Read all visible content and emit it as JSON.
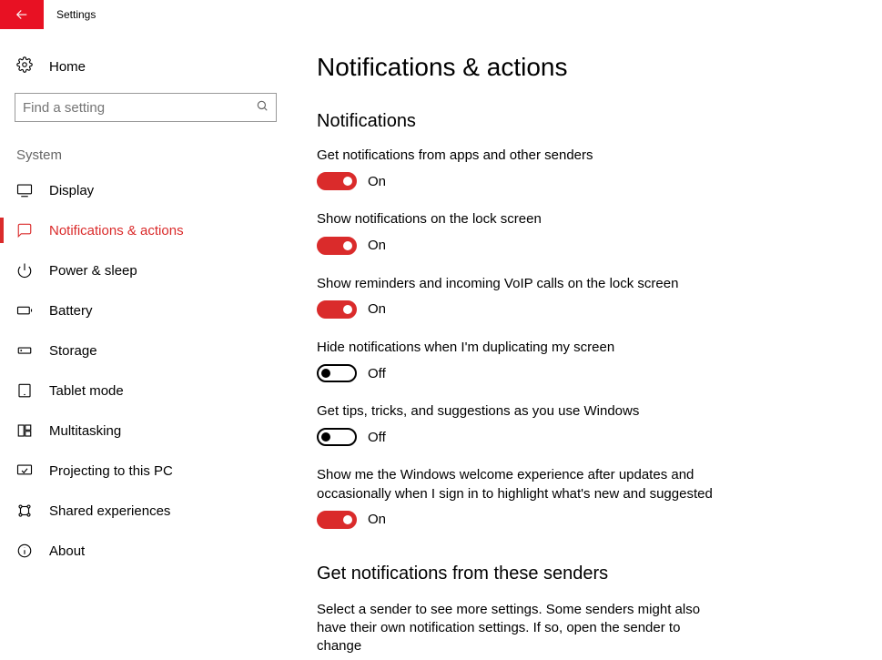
{
  "titlebar": {
    "app_name": "Settings"
  },
  "sidebar": {
    "home_label": "Home",
    "search_placeholder": "Find a setting",
    "group_label": "System",
    "items": [
      {
        "id": "display",
        "label": "Display",
        "icon": "display",
        "active": false
      },
      {
        "id": "notifications",
        "label": "Notifications & actions",
        "icon": "notifications",
        "active": true
      },
      {
        "id": "power",
        "label": "Power & sleep",
        "icon": "power",
        "active": false
      },
      {
        "id": "battery",
        "label": "Battery",
        "icon": "battery",
        "active": false
      },
      {
        "id": "storage",
        "label": "Storage",
        "icon": "storage",
        "active": false
      },
      {
        "id": "tablet",
        "label": "Tablet mode",
        "icon": "tablet",
        "active": false
      },
      {
        "id": "multitasking",
        "label": "Multitasking",
        "icon": "multitasking",
        "active": false
      },
      {
        "id": "projecting",
        "label": "Projecting to this PC",
        "icon": "projecting",
        "active": false
      },
      {
        "id": "shared",
        "label": "Shared experiences",
        "icon": "shared",
        "active": false
      },
      {
        "id": "about",
        "label": "About",
        "icon": "about",
        "active": false
      }
    ]
  },
  "main": {
    "page_title": "Notifications & actions",
    "section_title": "Notifications",
    "toggles": [
      {
        "label": "Get notifications from apps and other senders",
        "on": true,
        "state": "On"
      },
      {
        "label": "Show notifications on the lock screen",
        "on": true,
        "state": "On"
      },
      {
        "label": "Show reminders and incoming VoIP calls on the lock screen",
        "on": true,
        "state": "On"
      },
      {
        "label": "Hide notifications when I'm duplicating my screen",
        "on": false,
        "state": "Off"
      },
      {
        "label": "Get tips, tricks, and suggestions as you use Windows",
        "on": false,
        "state": "Off"
      },
      {
        "label": "Show me the Windows welcome experience after updates and occasionally when I sign in to highlight what's new and suggested",
        "on": true,
        "state": "On"
      }
    ],
    "senders_title": "Get notifications from these senders",
    "senders_desc": "Select a sender to see more settings. Some senders might also have their own notification settings. If so, open the sender to change"
  }
}
